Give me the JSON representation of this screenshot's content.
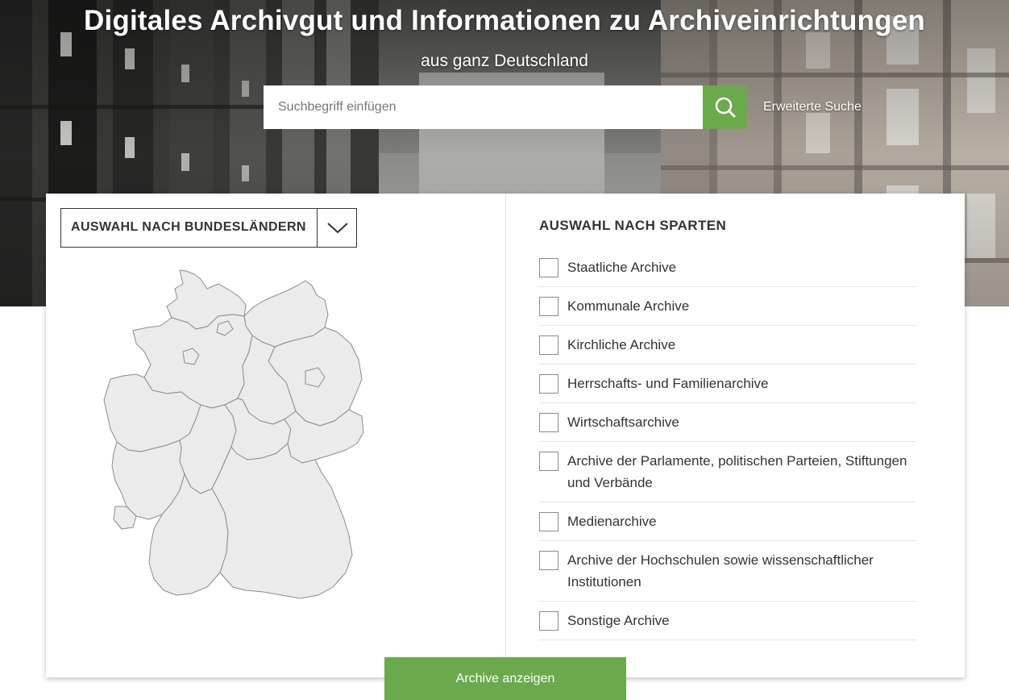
{
  "hero": {
    "title": "Digitales Archivgut und Informationen zu Archiveinrichtungen",
    "subtitle": "aus ganz Deutschland"
  },
  "search": {
    "placeholder": "Suchbegriff einfügen",
    "value": "",
    "button_icon": "search-icon",
    "advanced_link": "Erweiterte Suche"
  },
  "states": {
    "dropdown_label": "AUSWAHL NACH BUNDESLÄNDERN",
    "toggle_icon": "chevron-down-icon"
  },
  "categories": {
    "heading": "AUSWAHL NACH SPARTEN",
    "items": [
      {
        "label": "Staatliche Archive",
        "checked": false
      },
      {
        "label": "Kommunale Archive",
        "checked": false
      },
      {
        "label": "Kirchliche Archive",
        "checked": false
      },
      {
        "label": "Herrschafts- und Familienarchive",
        "checked": false
      },
      {
        "label": "Wirtschaftsarchive",
        "checked": false
      },
      {
        "label": "Archive der Parlamente, politischen Parteien, Stiftungen und Verbände",
        "checked": false
      },
      {
        "label": "Medienarchive",
        "checked": false
      },
      {
        "label": "Archive der Hochschulen sowie wissenschaftlicher Institutionen",
        "checked": false
      },
      {
        "label": "Sonstige Archive",
        "checked": false
      }
    ]
  },
  "actions": {
    "show_label": "Archive anzeigen"
  },
  "colors": {
    "accent": "#6aaa4c",
    "map_fill": "#ebebeb",
    "map_stroke": "#8c8c8c"
  }
}
